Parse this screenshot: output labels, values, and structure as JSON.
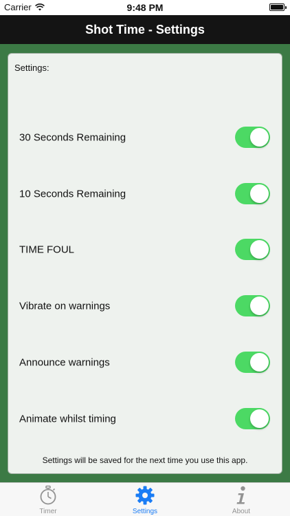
{
  "status_bar": {
    "carrier": "Carrier",
    "time": "9:48 PM"
  },
  "nav": {
    "title": "Shot Time - Settings"
  },
  "settings": {
    "heading": "Settings:",
    "items": [
      {
        "label": "30 Seconds Remaining",
        "on": true
      },
      {
        "label": "10 Seconds Remaining",
        "on": true
      },
      {
        "label": "TIME FOUL",
        "on": true
      },
      {
        "label": "Vibrate on warnings",
        "on": true
      },
      {
        "label": "Announce warnings",
        "on": true
      },
      {
        "label": "Animate whilst timing",
        "on": true
      }
    ],
    "footer": "Settings will be saved for the next time you use this app."
  },
  "tab_bar": {
    "tabs": [
      {
        "label": "Timer",
        "icon": "stopwatch-icon"
      },
      {
        "label": "Settings",
        "icon": "gear-icon",
        "active": true
      },
      {
        "label": "About",
        "icon": "info-icon"
      }
    ]
  },
  "colors": {
    "background": "#3c7a45",
    "toggle_on": "#4cd964",
    "tab_active": "#1a7cf5",
    "tab_inactive": "#929292"
  }
}
